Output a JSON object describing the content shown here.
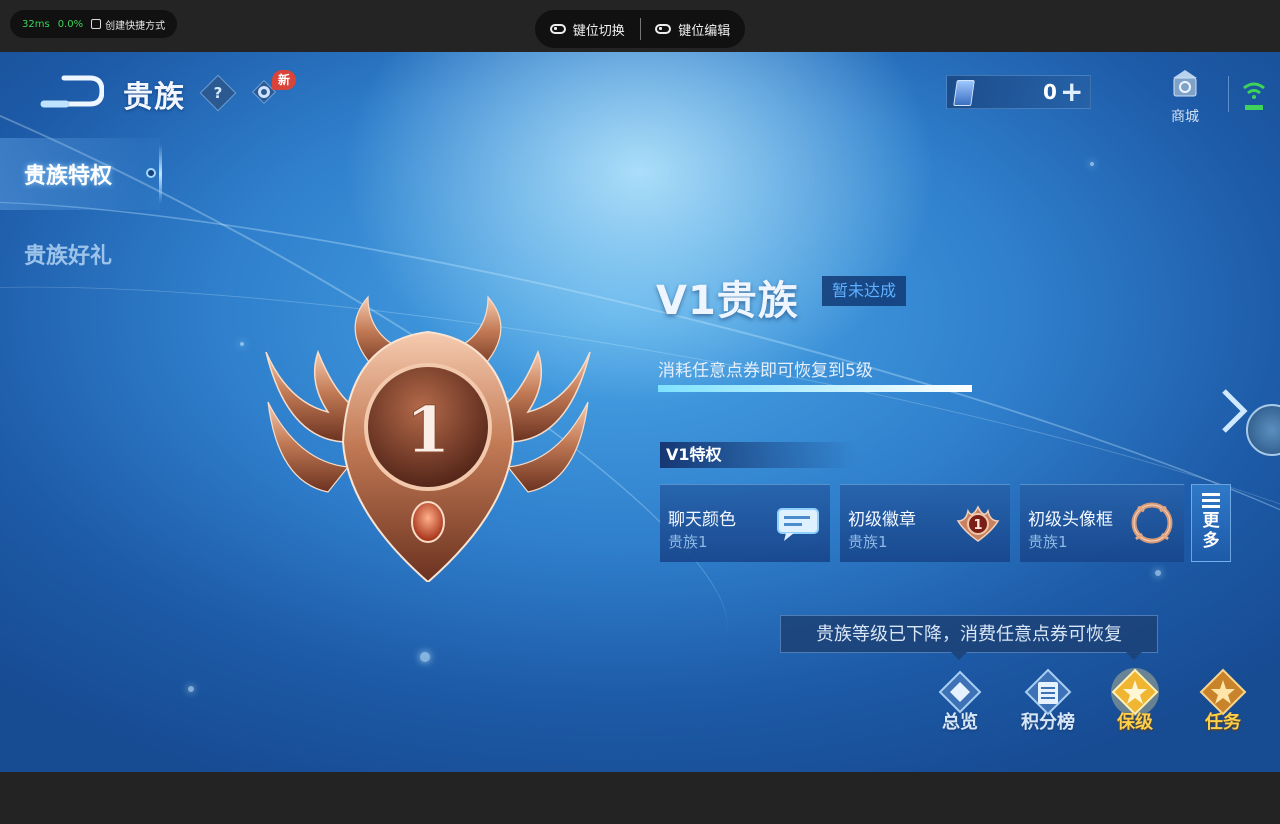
{
  "emulator": {
    "perf_ms": "32ms",
    "perf_pct": "0.0%",
    "shortcut_label": "创建快捷方式",
    "keymap_switch": "键位切换",
    "keymap_edit": "键位编辑"
  },
  "header": {
    "title": "贵族",
    "help": "?",
    "new_badge": "新"
  },
  "currency": {
    "value": "0",
    "add": "+"
  },
  "mall": {
    "label": "商城"
  },
  "side_nav": {
    "items": [
      {
        "label": "贵族特权",
        "active": true
      },
      {
        "label": "贵族好礼",
        "active": false
      }
    ]
  },
  "medal": {
    "level": "1"
  },
  "tier": {
    "title": "V1贵族",
    "status": "暂未达成",
    "restore_text": "消耗任意点券即可恢复到5级",
    "progress": 1.0
  },
  "privileges": {
    "header": "V1特权",
    "cards": [
      {
        "name": "聊天颜色",
        "sub": "贵族1",
        "icon": "chat-bubble-icon"
      },
      {
        "name": "初级徽章",
        "sub": "贵族1",
        "icon": "badge-icon"
      },
      {
        "name": "初级头像框",
        "sub": "贵族1",
        "icon": "avatar-frame-icon"
      }
    ],
    "more": "更多"
  },
  "tooltip": "贵族等级已下降，消费任意点券可恢复",
  "tabs": [
    {
      "label": "总览",
      "style": "blue"
    },
    {
      "label": "积分榜",
      "style": "blue"
    },
    {
      "label": "保级",
      "style": "gold"
    },
    {
      "label": "任务",
      "style": "gold"
    }
  ],
  "colors": {
    "accent_blue": "#2f7fcc",
    "progress": "#7fe2ff",
    "badge_red": "#d9443a",
    "gold": "#ffcf4a",
    "bronze": "#b86a45"
  }
}
